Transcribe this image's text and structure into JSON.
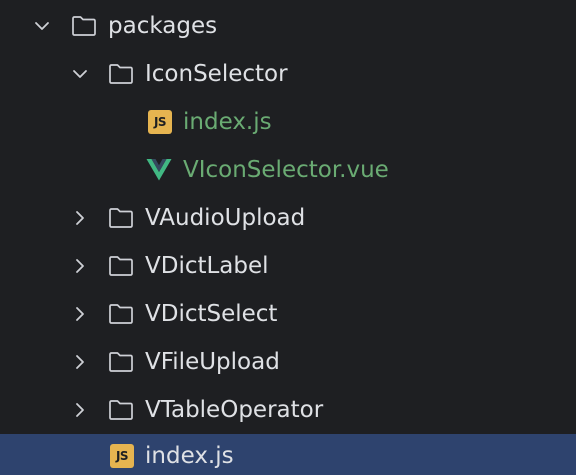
{
  "colors": {
    "background": "#1e1f22",
    "selected_row": "#2e436e",
    "text": "#dfe1e5",
    "modified_text": "#6aab73",
    "folder_icon": "#ced0d6",
    "js_badge": "#e6b450",
    "vue_green": "#41b883",
    "vue_dark": "#35495e"
  },
  "tree": {
    "root": {
      "label": "packages",
      "icon": "folder-icon",
      "expanded": true
    },
    "icon_selector": {
      "label": "IconSelector",
      "icon": "folder-icon",
      "expanded": true
    },
    "icon_selector_index": {
      "label": "index.js",
      "icon": "javascript-file-icon",
      "badge": "JS"
    },
    "vicon_selector_vue": {
      "label": "VIconSelector.vue",
      "icon": "vue-file-icon"
    },
    "vaudio_upload": {
      "label": "VAudioUpload",
      "icon": "folder-icon",
      "expanded": false
    },
    "vdict_label": {
      "label": "VDictLabel",
      "icon": "folder-icon",
      "expanded": false
    },
    "vdict_select": {
      "label": "VDictSelect",
      "icon": "folder-icon",
      "expanded": false
    },
    "vfile_upload": {
      "label": "VFileUpload",
      "icon": "folder-icon",
      "expanded": false
    },
    "vtable_operator": {
      "label": "VTableOperator",
      "icon": "folder-icon",
      "expanded": false
    },
    "packages_index": {
      "label": "index.js",
      "icon": "javascript-file-icon",
      "badge": "JS",
      "selected": true
    }
  }
}
